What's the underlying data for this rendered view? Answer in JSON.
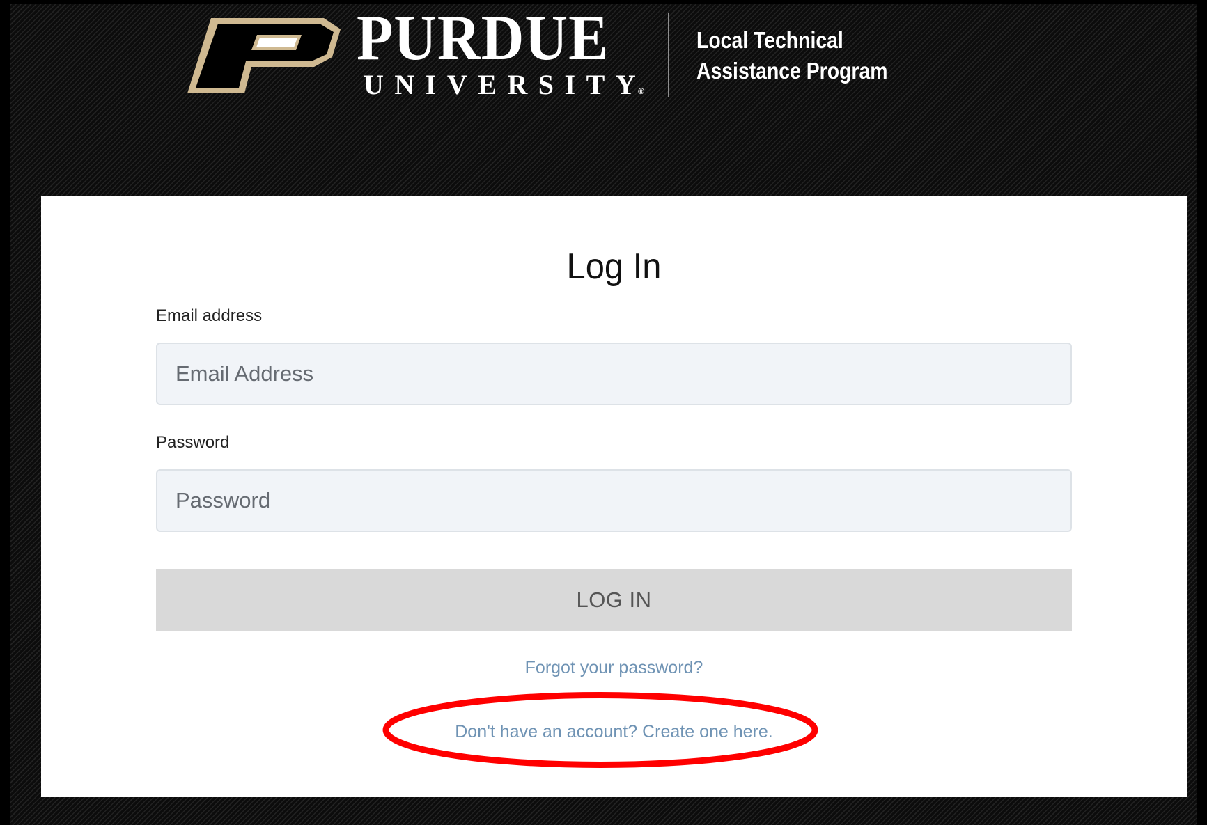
{
  "header": {
    "logo_letter": "P",
    "university_name": "PURDUE",
    "university_suffix": "UNIVERSITY",
    "registered_mark": "®",
    "program_line_1": "Local Technical",
    "program_line_2": "Assistance Program"
  },
  "login": {
    "title": "Log In",
    "email_label": "Email address",
    "email_placeholder": "Email Address",
    "password_label": "Password",
    "password_placeholder": "Password",
    "submit_label": "LOG IN",
    "forgot_link": "Forgot your password?",
    "create_account_link": "Don't have an account? Create one here."
  },
  "colors": {
    "background": "#0c0c0c",
    "brand_gold": "#cfb991",
    "link": "#6f93b4",
    "highlight": "#ff0000"
  }
}
